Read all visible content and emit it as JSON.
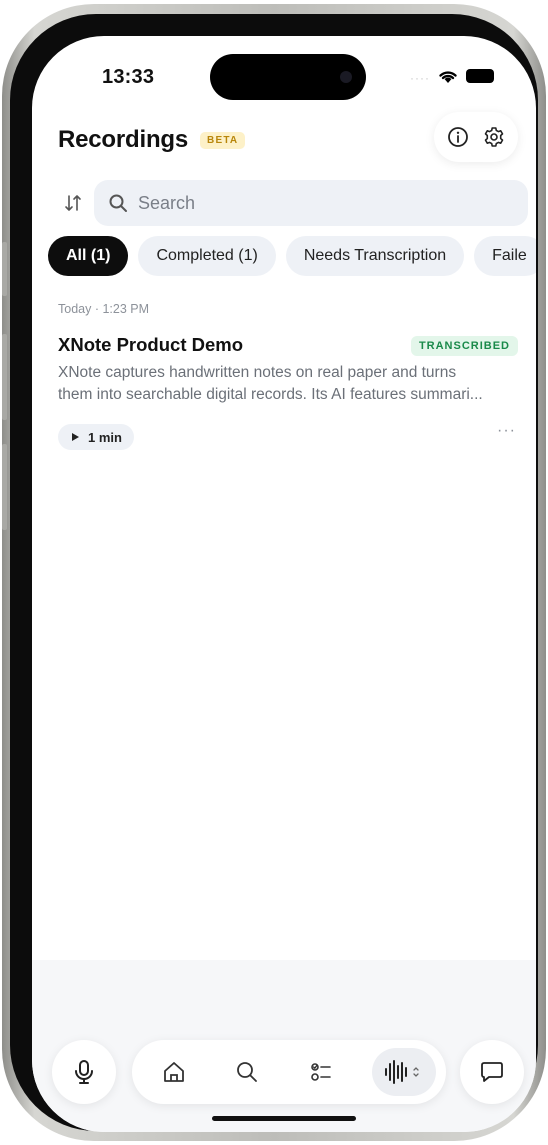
{
  "status_bar": {
    "time": "13:33"
  },
  "header": {
    "title": "Recordings",
    "badge": "BETA"
  },
  "search": {
    "placeholder": "Search"
  },
  "filters": [
    {
      "label": "All (1)",
      "active": true
    },
    {
      "label": "Completed (1)",
      "active": false
    },
    {
      "label": "Needs Transcription",
      "active": false
    },
    {
      "label": "Faile",
      "active": false
    }
  ],
  "recordings": [
    {
      "date": "Today · 1:23 PM",
      "title": "XNote Product Demo",
      "status": "TRANSCRIBED",
      "description_line1": "XNote captures handwritten notes on real paper and turns",
      "description_line2": "them into searchable digital records. Its AI features summari...",
      "duration": "1 min"
    }
  ],
  "colors": {
    "accent": "#0d0d0d",
    "status_green": "#1a8a4a",
    "beta_gold": "#b8860b",
    "chip_bg": "#eef1f6"
  },
  "icons": [
    "info-icon",
    "gear-icon",
    "sort-icon",
    "search-icon",
    "play-icon",
    "more-icon",
    "mic-icon",
    "home-icon",
    "search-icon",
    "checklist-icon",
    "waveform-icon",
    "chat-icon"
  ]
}
